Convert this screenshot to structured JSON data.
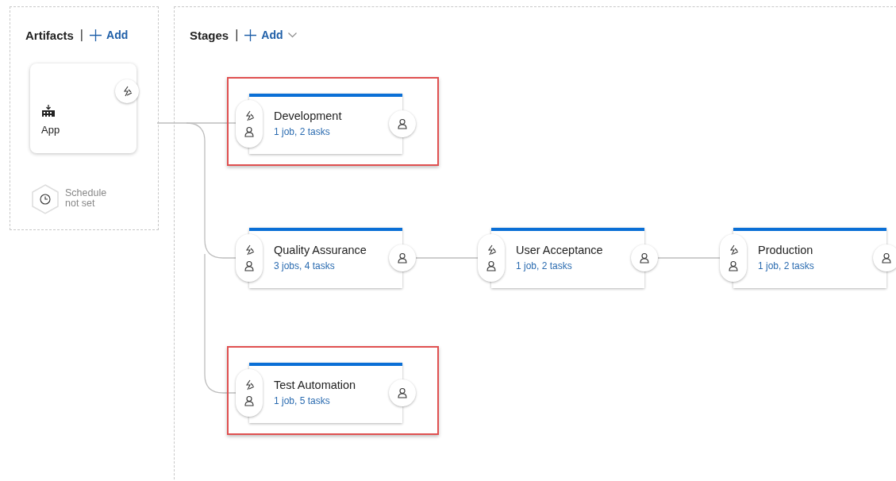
{
  "artifacts_panel": {
    "title": "Artifacts",
    "separator": "|",
    "add_label": "Add",
    "artifact": {
      "name": "App"
    },
    "schedule": "Schedule not set"
  },
  "stages_panel": {
    "title": "Stages",
    "separator": "|",
    "add_label": "Add"
  },
  "stages": [
    {
      "name": "Development",
      "summary": "1 job, 2 tasks",
      "highlighted": true
    },
    {
      "name": "Quality Assurance",
      "summary": "3 jobs, 4 tasks",
      "highlighted": false
    },
    {
      "name": "User Acceptance",
      "summary": "1 job, 2 tasks",
      "highlighted": false
    },
    {
      "name": "Production",
      "summary": "1 job, 2 tasks",
      "highlighted": false
    },
    {
      "name": "Test Automation",
      "summary": "1 job, 5 tasks",
      "highlighted": true
    }
  ]
}
